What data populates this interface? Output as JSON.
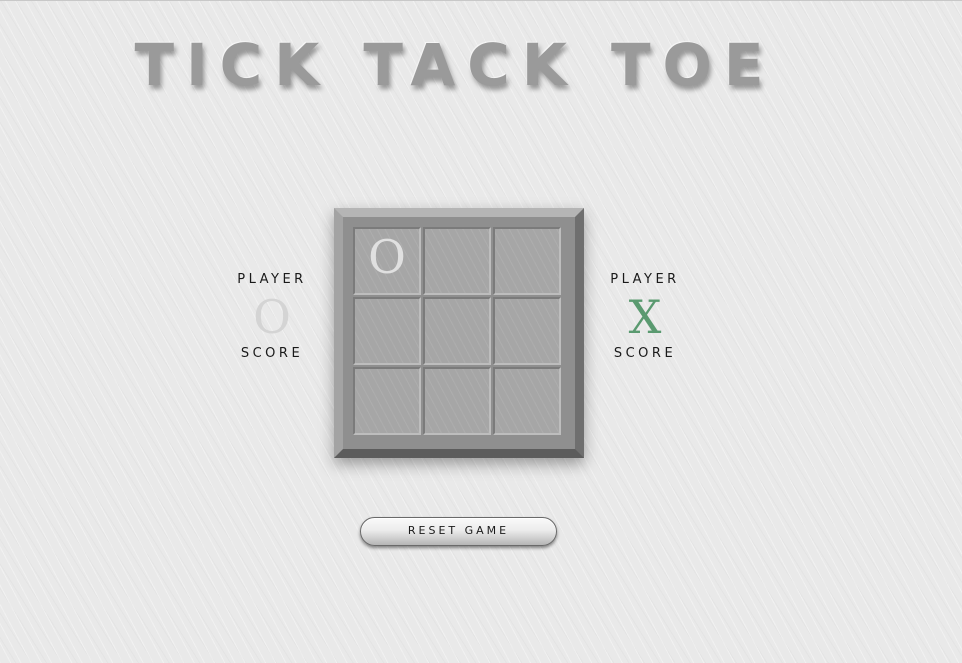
{
  "title": "TICK TACK TOE",
  "players": [
    {
      "label": "PLAYER",
      "mark": "O",
      "score_label": "SCORE",
      "color": "#d4d4d4"
    },
    {
      "label": "PLAYER",
      "mark": "X",
      "score_label": "SCORE",
      "color": "#5a9a70"
    }
  ],
  "board": {
    "cells": [
      "O",
      "",
      "",
      "",
      "",
      "",
      "",
      "",
      ""
    ]
  },
  "reset_button": {
    "label": "RESET GAME"
  }
}
